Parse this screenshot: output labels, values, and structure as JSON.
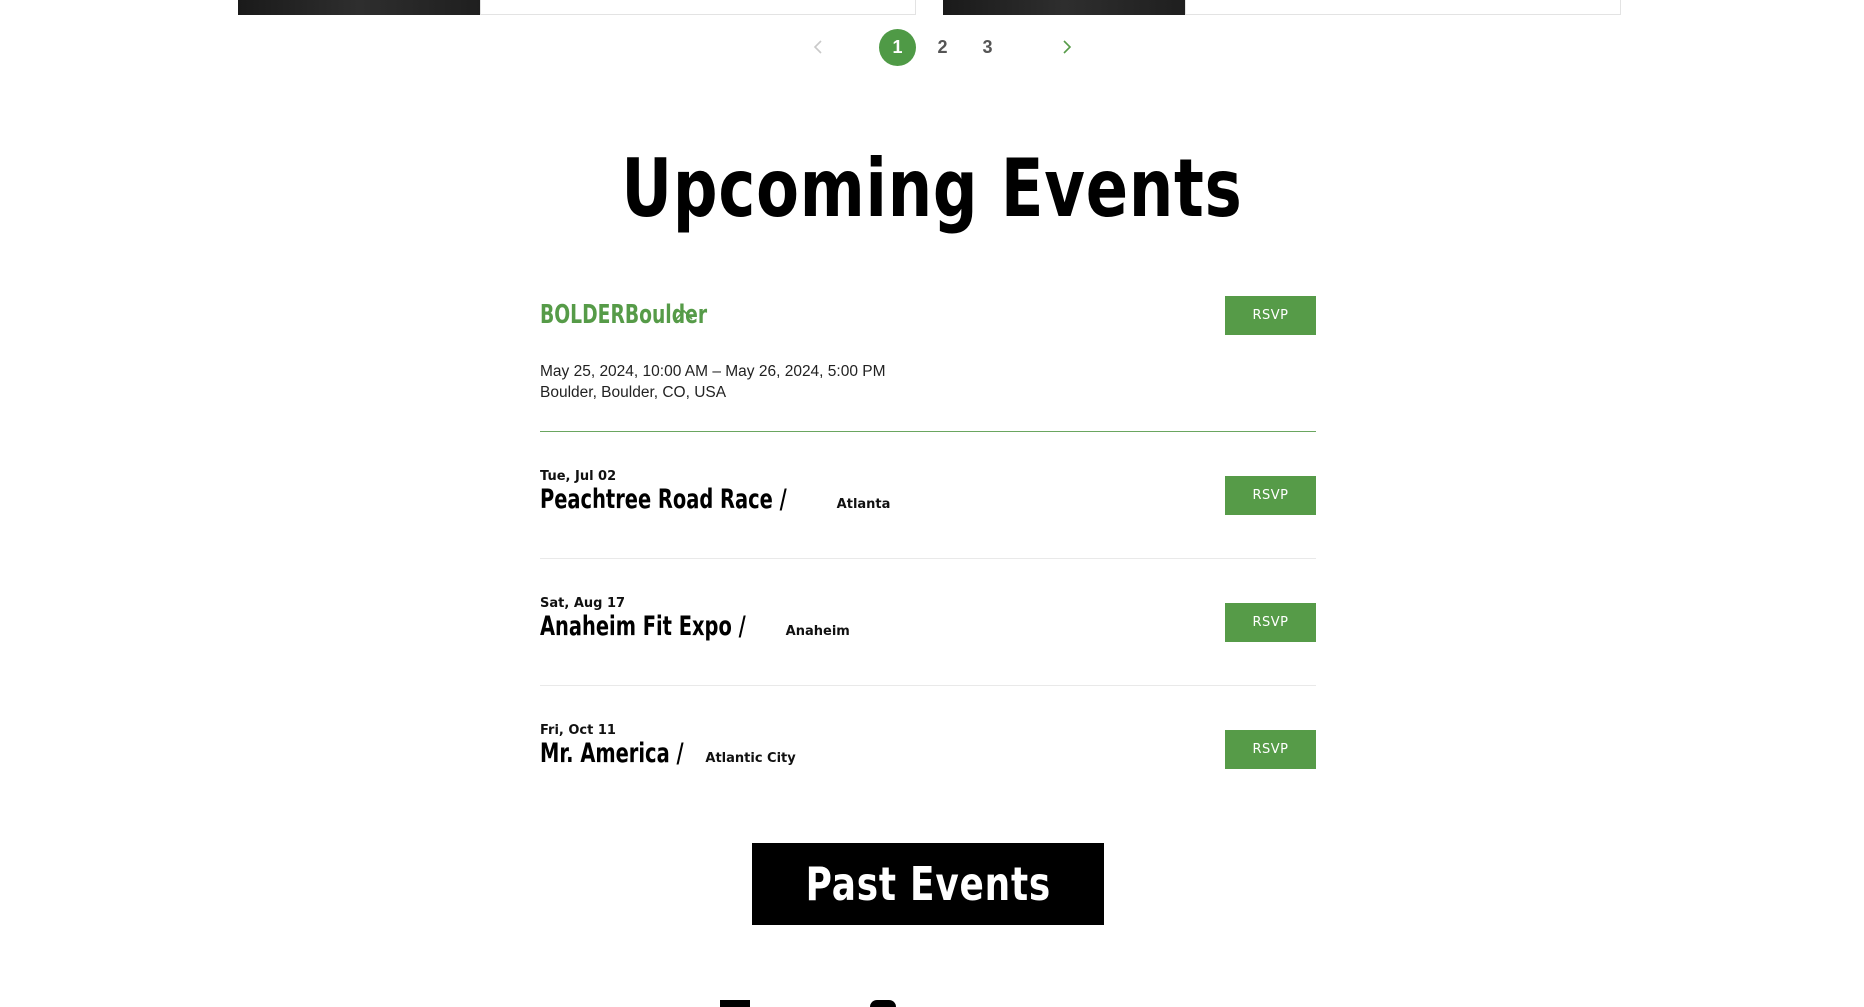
{
  "pagination": {
    "prev_icon": "chevron-left-icon",
    "next_icon": "chevron-right-icon",
    "pages": [
      "1",
      "2",
      "3"
    ],
    "active_page": "1"
  },
  "section": {
    "title": "Upcoming Events"
  },
  "featured_event": {
    "name": "BOLDERBoulder",
    "toggle_icon": "chevron-up-icon",
    "datetime": "May 25, 2024, 10:00 AM – May 26, 2024, 5:00 PM",
    "location": "Boulder, Boulder, CO, USA",
    "rsvp_label": "RSVP"
  },
  "events": [
    {
      "date": "Tue, Jul 02",
      "name": "Peachtree Road Race /",
      "city": "Atlanta",
      "rsvp_label": "RSVP"
    },
    {
      "date": "Sat, Aug 17",
      "name": "Anaheim Fit Expo /",
      "city": "Anaheim",
      "rsvp_label": "RSVP"
    },
    {
      "date": "Fri, Oct 11",
      "name": "Mr. America /",
      "city": "Atlantic City",
      "rsvp_label": "RSVP"
    }
  ],
  "past_events_button": "Past Events",
  "colors": {
    "accent": "#569b48",
    "active_page": "#4f9a46",
    "button_dark": "#000000"
  }
}
